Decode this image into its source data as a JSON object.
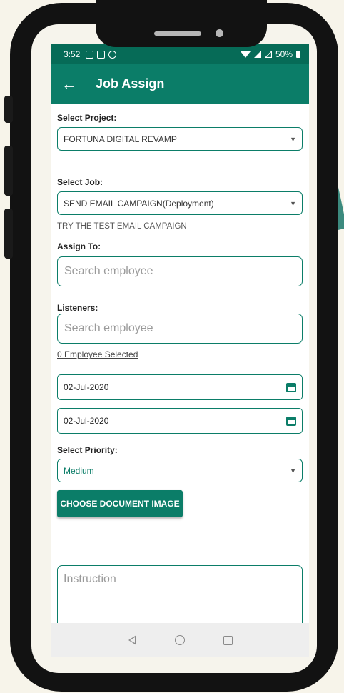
{
  "status_bar": {
    "time": "3:52",
    "battery": "50%"
  },
  "app_bar": {
    "title": "Job Assign"
  },
  "project": {
    "label": "Select Project:",
    "value": "FORTUNA DIGITAL REVAMP"
  },
  "job": {
    "label": "Select Job:",
    "value": "SEND EMAIL CAMPAIGN(Deployment)",
    "description": "TRY THE TEST EMAIL CAMPAIGN"
  },
  "assign_to": {
    "label": "Assign To:",
    "placeholder": "Search employee"
  },
  "listeners": {
    "label": "Listeners:",
    "placeholder": "Search employee",
    "selected_text": "0 Employee Selected"
  },
  "dates": {
    "start": "02-Jul-2020",
    "end": "02-Jul-2020"
  },
  "priority": {
    "label": "Select Priority:",
    "value": "Medium"
  },
  "choose_document": {
    "label": "CHOOSE DOCUMENT IMAGE"
  },
  "instruction": {
    "placeholder": "Instruction"
  },
  "colors": {
    "primary": "#0b7d68",
    "status_bar": "#066b57",
    "background": "#f7f4ea",
    "decor_shape": "#3c8a7e"
  }
}
